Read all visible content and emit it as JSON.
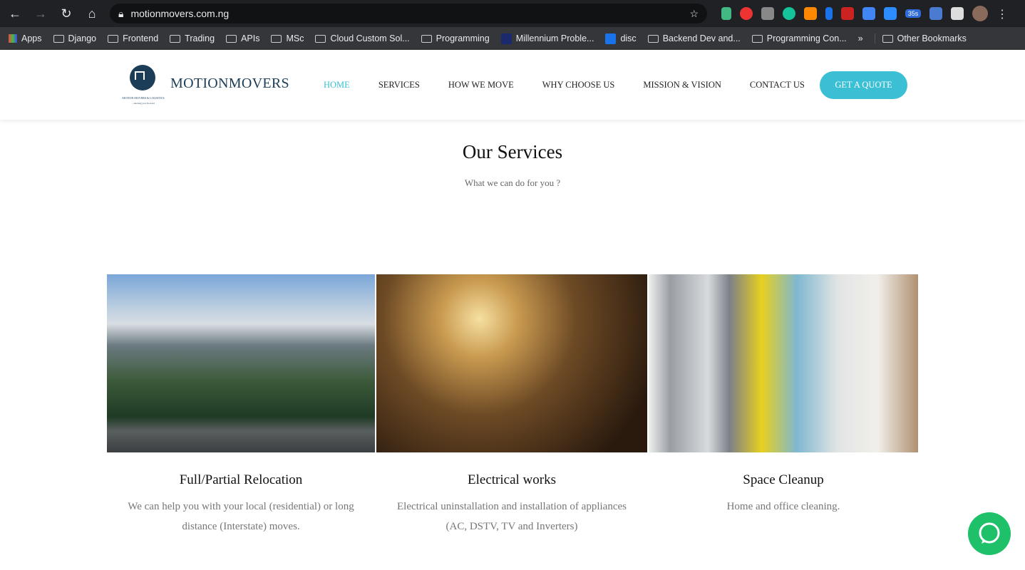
{
  "browser": {
    "url": "motionmovers.com.ng",
    "badge": "35s",
    "bookmarks": [
      "Apps",
      "Django",
      "Frontend",
      "Trading",
      "APIs",
      "MSc",
      "Cloud Custom Sol...",
      "Programming",
      "Millennium Proble...",
      "disc",
      "Backend Dev and...",
      "Programming Con...",
      "»",
      "Other Bookmarks"
    ]
  },
  "header": {
    "brand": "MOTIONMOVERS",
    "logo_text": "MOTION MOVERS & LOGISTICS",
    "logo_tagline": "...moving you forward",
    "menu": [
      "HOME",
      "SERVICES",
      "HOW WE MOVE",
      "WHY CHOOSE US",
      "MISSION & VISION",
      "CONTACT US"
    ],
    "cta": "GET A QUOTE",
    "accent": "#3bbfd4"
  },
  "main": {
    "title": "Our Services",
    "subtitle": "What we can do for you ?",
    "services": [
      {
        "title": "Full/Partial Relocation",
        "text": "We can help you with your local (residential) or long distance (Interstate) moves.",
        "image": "mountain-truck"
      },
      {
        "title": "Electrical works",
        "text": "Electrical uninstallation and installation of appliances (AC, DSTV, TV and Inverters)",
        "image": "lightbulb-plug"
      },
      {
        "title": "Space Cleanup",
        "text": "Home and office cleaning.",
        "image": "vacuum-cleaning-supplies"
      }
    ]
  }
}
